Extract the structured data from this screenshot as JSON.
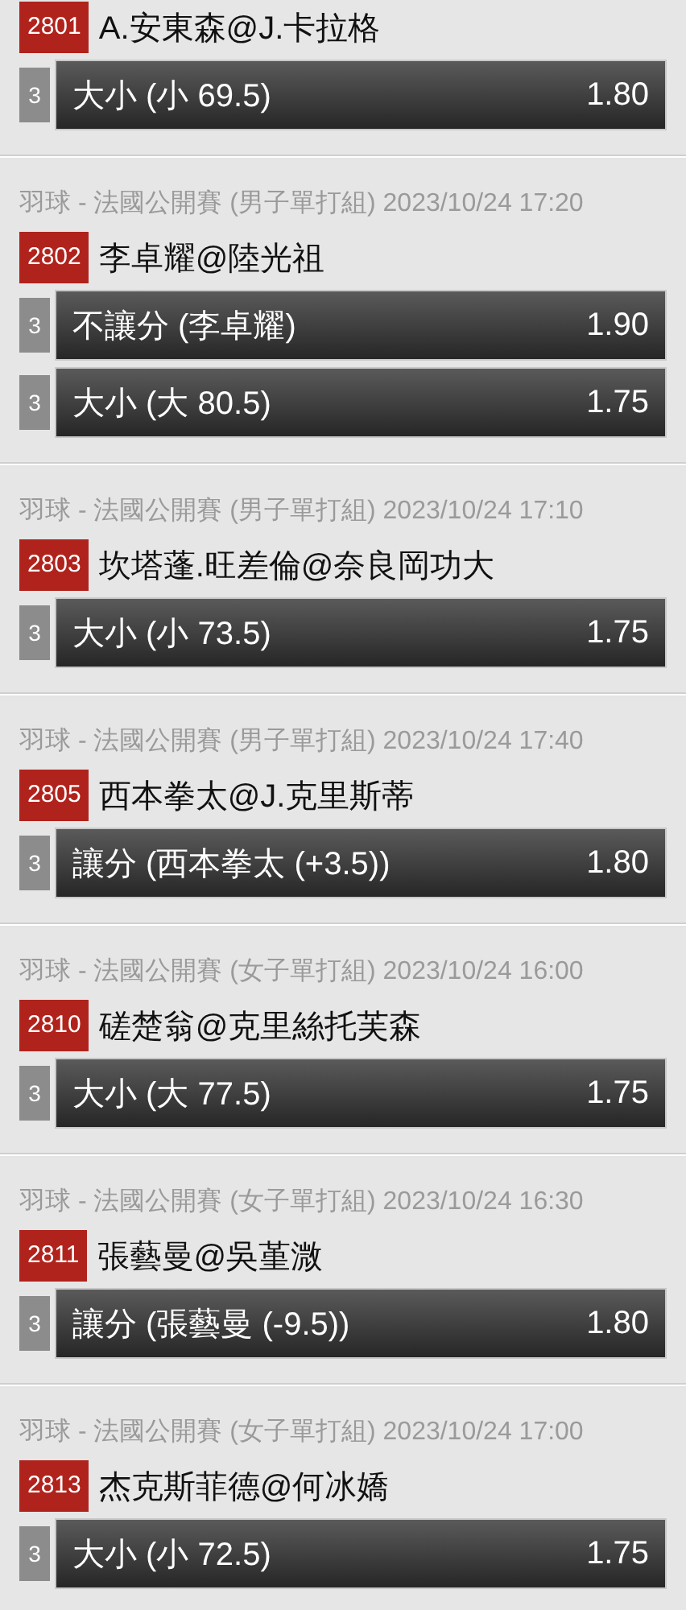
{
  "events": [
    {
      "code": "2801",
      "match": "A.安東森@J.卡拉格",
      "bets": [
        {
          "count": "3",
          "market": "大小 (小 69.5)",
          "odds": "1.80"
        }
      ]
    },
    {
      "header": "羽球 - 法國公開賽 (男子單打組) 2023/10/24 17:20",
      "code": "2802",
      "match": "李卓耀@陸光祖",
      "bets": [
        {
          "count": "3",
          "market": "不讓分 (李卓耀)",
          "odds": "1.90"
        },
        {
          "count": "3",
          "market": "大小 (大 80.5)",
          "odds": "1.75"
        }
      ]
    },
    {
      "header": "羽球 - 法國公開賽 (男子單打組) 2023/10/24 17:10",
      "code": "2803",
      "match": "坎塔蓬.旺差倫@奈良岡功大",
      "bets": [
        {
          "count": "3",
          "market": "大小 (小 73.5)",
          "odds": "1.75"
        }
      ]
    },
    {
      "header": "羽球 - 法國公開賽 (男子單打組) 2023/10/24 17:40",
      "code": "2805",
      "match": "西本拳太@J.克里斯蒂",
      "bets": [
        {
          "count": "3",
          "market": "讓分 (西本拳太 (+3.5))",
          "odds": "1.80"
        }
      ]
    },
    {
      "header": "羽球 - 法國公開賽 (女子單打組) 2023/10/24 16:00",
      "code": "2810",
      "match": "磋楚翁@克里絲托芙森",
      "bets": [
        {
          "count": "3",
          "market": "大小 (大 77.5)",
          "odds": "1.75"
        }
      ]
    },
    {
      "header": "羽球 - 法國公開賽 (女子單打組) 2023/10/24 16:30",
      "code": "2811",
      "match": "張藝曼@吳堇溦",
      "bets": [
        {
          "count": "3",
          "market": "讓分 (張藝曼 (-9.5))",
          "odds": "1.80"
        }
      ]
    },
    {
      "header": "羽球 - 法國公開賽 (女子單打組) 2023/10/24 17:00",
      "code": "2813",
      "match": "杰克斯菲德@何冰嬌",
      "bets": [
        {
          "count": "3",
          "market": "大小 (小 72.5)",
          "odds": "1.75"
        }
      ]
    }
  ]
}
